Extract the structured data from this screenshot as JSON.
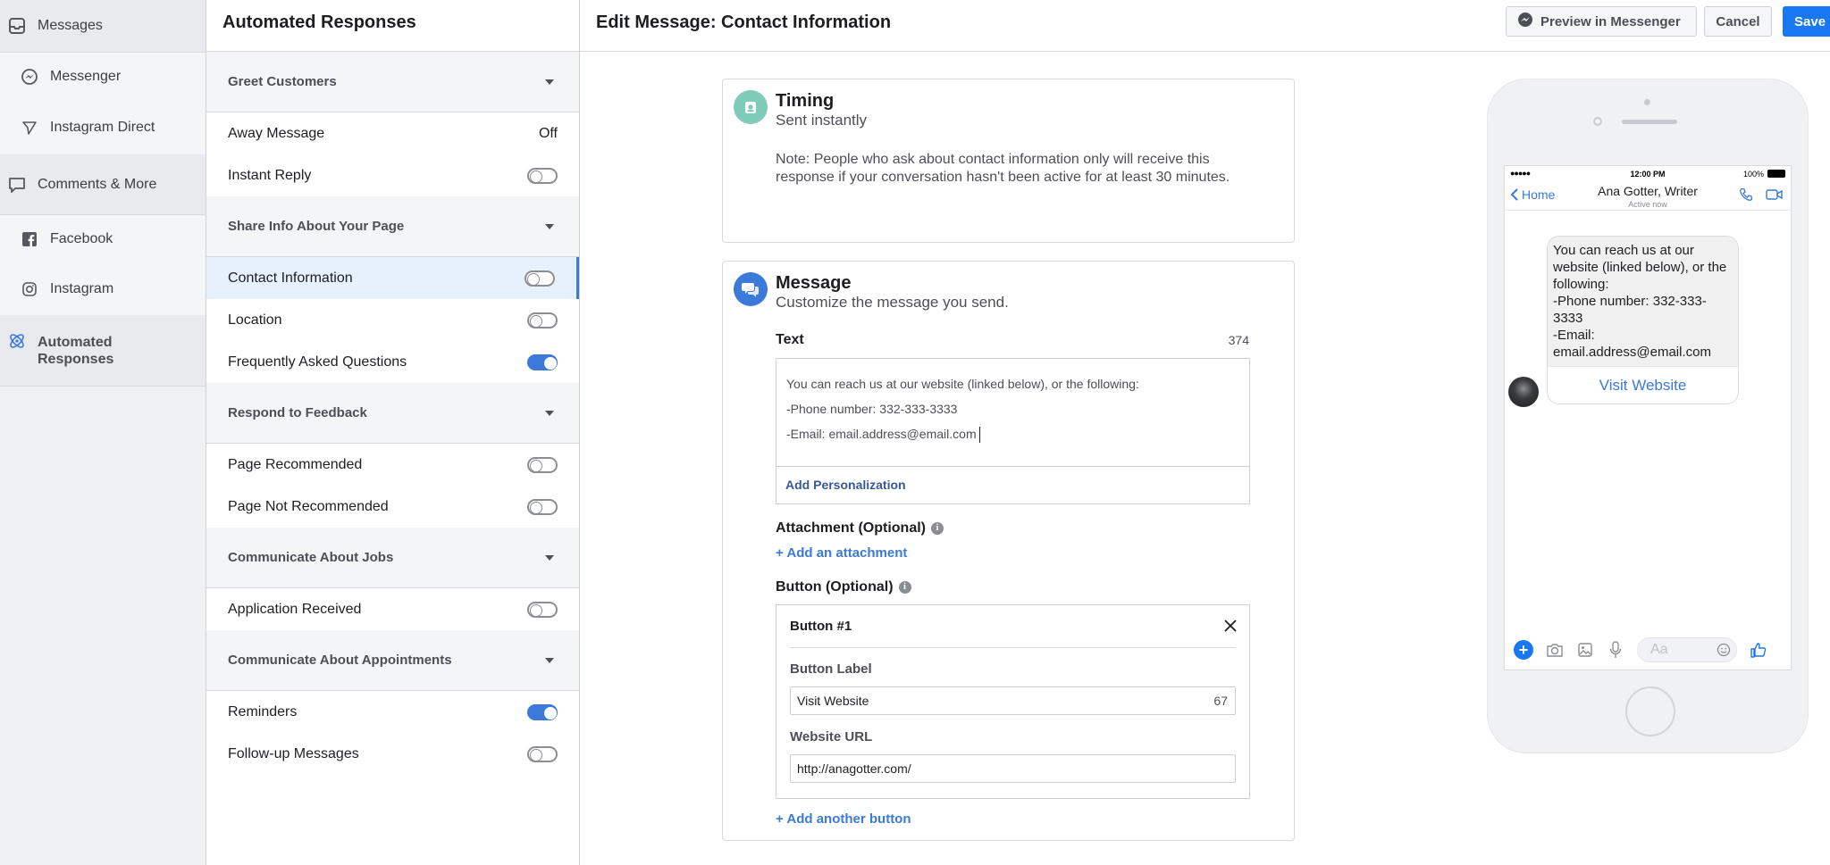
{
  "nav": {
    "messages": "Messages",
    "messenger": "Messenger",
    "instagram_direct": "Instagram Direct",
    "comments_more": "Comments & More",
    "facebook": "Facebook",
    "instagram": "Instagram",
    "automated_responses_line1": "Automated",
    "automated_responses_line2": "Responses"
  },
  "mid": {
    "title": "Automated Responses",
    "sections": [
      {
        "title": "Greet Customers",
        "rows": [
          {
            "label": "Away Message",
            "value": "Off"
          },
          {
            "label": "Instant Reply",
            "toggle": false
          }
        ]
      },
      {
        "title": "Share Info About Your Page",
        "rows": [
          {
            "label": "Contact Information",
            "toggle": false,
            "selected": true
          },
          {
            "label": "Location",
            "toggle": false
          },
          {
            "label": "Frequently Asked Questions",
            "toggle": true
          }
        ]
      },
      {
        "title": "Respond to Feedback",
        "rows": [
          {
            "label": "Page Recommended",
            "toggle": false
          },
          {
            "label": "Page Not Recommended",
            "toggle": false
          }
        ]
      },
      {
        "title": "Communicate About Jobs",
        "rows": [
          {
            "label": "Application Received",
            "toggle": false
          }
        ]
      },
      {
        "title": "Communicate About Appointments",
        "rows": [
          {
            "label": "Reminders",
            "toggle": true
          },
          {
            "label": "Follow-up Messages",
            "toggle": false
          }
        ]
      }
    ]
  },
  "header": {
    "title": "Edit Message: Contact Information",
    "preview": "Preview in Messenger",
    "cancel": "Cancel",
    "save": "Save"
  },
  "timing": {
    "title": "Timing",
    "subtitle": "Sent instantly",
    "note": "Note: People who ask about contact information only will receive this response if your conversation hasn't been active for at least 30 minutes."
  },
  "message": {
    "title": "Message",
    "subtitle": "Customize the message you send.",
    "text_label": "Text",
    "text_count": "374",
    "text_lines": [
      "You can reach us at our website (linked below), or the following:",
      "-Phone number: 332-333-3333",
      "-Email: email.address@email.com"
    ],
    "add_personalization": "Add Personalization",
    "attachment_label": "Attachment (Optional)",
    "add_attachment": "+ Add an attachment",
    "button_label": "Button (Optional)",
    "button1": {
      "title": "Button #1",
      "label_title": "Button Label",
      "label_value": "Visit Website",
      "label_count": "67",
      "url_title": "Website URL",
      "url_value": "http://anagotter.com/"
    },
    "add_button": "+ Add another button"
  },
  "phone": {
    "signal": "●●●●● ",
    "time": "12:00 PM",
    "battery": "100%",
    "back": "Home",
    "contact": "Ana Gotter, Writer",
    "status": "Active now",
    "bubble_lines": [
      "You can reach us at our website (linked below), or the following:",
      "-Phone number: 332-333-3333",
      "-Email:",
      "email.address@email.com"
    ],
    "bubble_button": "Visit Website",
    "composer_placeholder": "Aa"
  },
  "colors": {
    "accent": "#3b7ad9",
    "save": "#1877f2",
    "timing_icon": "#7ecbb7",
    "message_icon": "#3b7ad9"
  }
}
